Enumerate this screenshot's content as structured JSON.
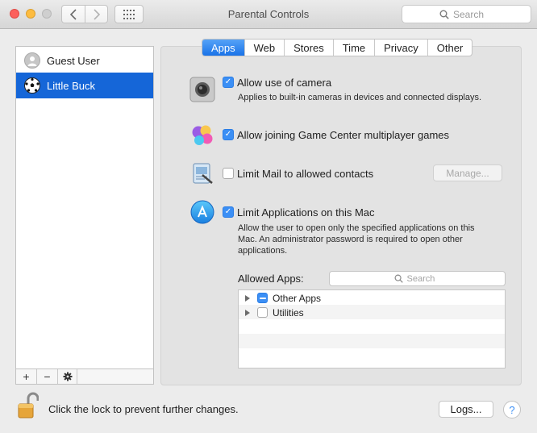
{
  "window": {
    "title": "Parental Controls"
  },
  "toolbar": {
    "back_icon": "chevron-left-icon",
    "forward_icon": "chevron-right-icon",
    "grid_icon": "grid-icon",
    "search_placeholder": "Search"
  },
  "users": [
    {
      "name": "Guest User",
      "icon": "guest-avatar-icon",
      "selected": false
    },
    {
      "name": "Little Buck",
      "icon": "soccer-ball-icon",
      "selected": true
    }
  ],
  "list_toolbar": {
    "add": "+",
    "remove": "−"
  },
  "tabs": [
    {
      "label": "Apps",
      "active": true
    },
    {
      "label": "Web",
      "active": false
    },
    {
      "label": "Stores",
      "active": false
    },
    {
      "label": "Time",
      "active": false
    },
    {
      "label": "Privacy",
      "active": false
    },
    {
      "label": "Other",
      "active": false
    }
  ],
  "settings": {
    "camera": {
      "label": "Allow use of camera",
      "checked": true,
      "description": "Applies to built-in cameras in devices and connected displays."
    },
    "game_center": {
      "label": "Allow joining Game Center multiplayer games",
      "checked": true
    },
    "mail": {
      "label": "Limit Mail to allowed contacts",
      "checked": false,
      "manage_label": "Manage..."
    },
    "applications": {
      "label": "Limit Applications on this Mac",
      "checked": true,
      "description_line1": "Allow the user to open only the specified applications on this",
      "description_line2": "Mac. An administrator password is required to open other",
      "description_line3": "applications."
    }
  },
  "allowed_apps": {
    "label": "Allowed Apps:",
    "search_placeholder": "Search",
    "rows": [
      {
        "label": "Other Apps",
        "state": "mixed"
      },
      {
        "label": "Utilities",
        "state": "unchecked"
      }
    ]
  },
  "footer": {
    "lock_text": "Click the lock to prevent further changes.",
    "logs_label": "Logs...",
    "help_label": "?"
  },
  "colors": {
    "accent": "#1a73e8",
    "selection": "#1566d8",
    "checkbox": "#3b8ff5"
  }
}
